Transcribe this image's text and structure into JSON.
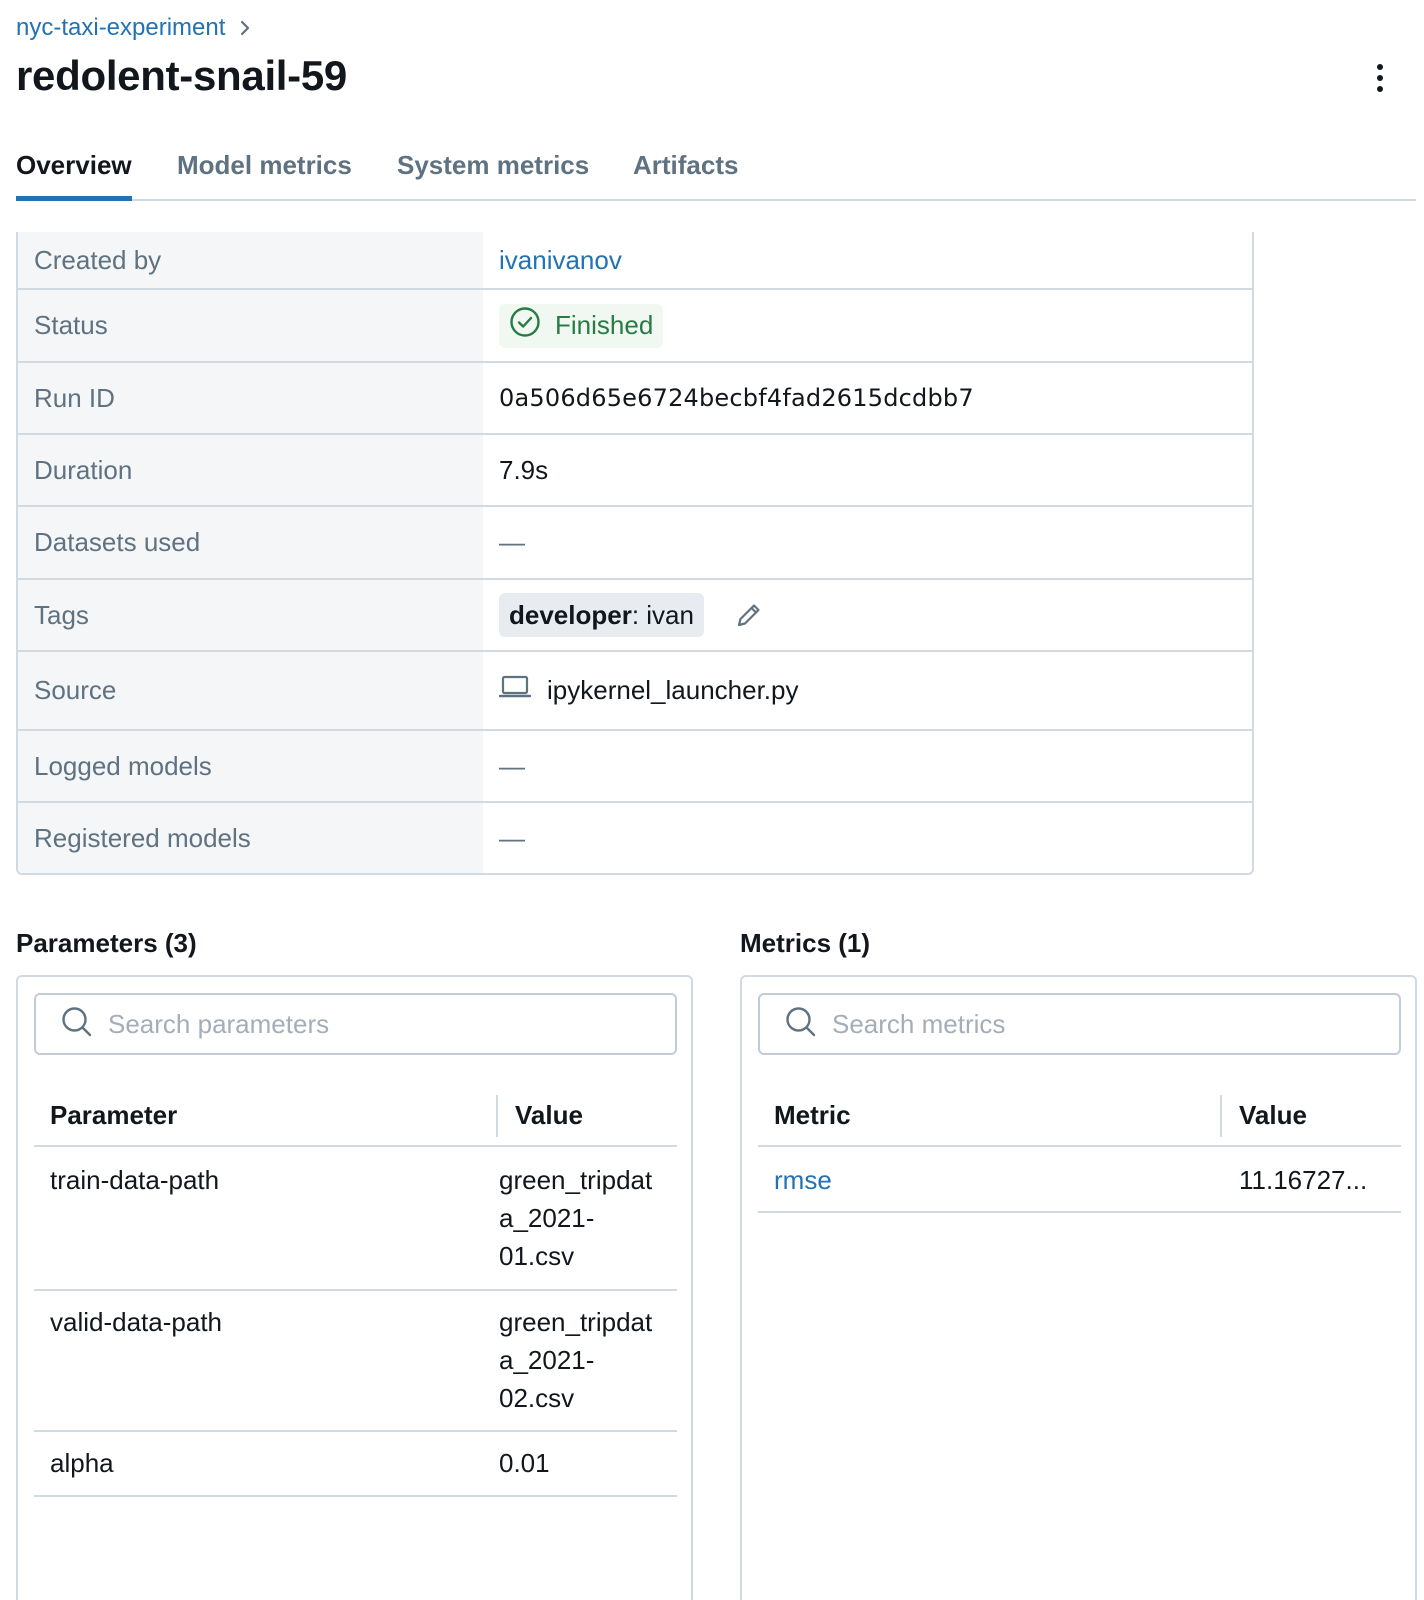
{
  "breadcrumb": {
    "experiment": "nyc-taxi-experiment"
  },
  "page": {
    "title": "redolent-snail-59"
  },
  "tabs": [
    {
      "label": "Overview"
    },
    {
      "label": "Model metrics"
    },
    {
      "label": "System metrics"
    },
    {
      "label": "Artifacts"
    }
  ],
  "details": {
    "created_by": {
      "label": "Created by",
      "value": "ivanivanov"
    },
    "status": {
      "label": "Status",
      "value": "Finished"
    },
    "run_id": {
      "label": "Run ID",
      "value": "0a506d65e6724becbf4fad2615dcdbb7"
    },
    "duration": {
      "label": "Duration",
      "value": "7.9s"
    },
    "datasets": {
      "label": "Datasets used",
      "value": "—"
    },
    "tags": {
      "label": "Tags",
      "key": "developer",
      "sep": ": ",
      "value": "ivan"
    },
    "source": {
      "label": "Source",
      "value": "ipykernel_launcher.py"
    },
    "logged_models": {
      "label": "Logged models",
      "value": "—"
    },
    "registered_models": {
      "label": "Registered models",
      "value": "—"
    }
  },
  "parameters": {
    "title": "Parameters (3)",
    "search_placeholder": "Search parameters",
    "col_name": "Parameter",
    "col_value": "Value",
    "rows": [
      {
        "name": "train-data-path",
        "value_lines": [
          "green_tripdat",
          "a_2021-",
          "01.csv"
        ]
      },
      {
        "name": "valid-data-path",
        "value_lines": [
          "green_tripdat",
          "a_2021-",
          "02.csv"
        ]
      },
      {
        "name": "alpha",
        "value_lines": [
          "0.01"
        ]
      }
    ]
  },
  "metrics": {
    "title": "Metrics (1)",
    "search_placeholder": "Search metrics",
    "col_name": "Metric",
    "col_value": "Value",
    "rows": [
      {
        "name": "rmse",
        "value": "11.16727..."
      }
    ]
  },
  "colors": {
    "accent": "#2272b4",
    "success": "#277c43",
    "border": "#d1d9e1",
    "label_bg": "#f4f6f8"
  },
  "icons": [
    "chevron-right-icon",
    "kebab-menu-icon",
    "check-circle-icon",
    "pencil-icon",
    "laptop-icon",
    "search-icon"
  ]
}
